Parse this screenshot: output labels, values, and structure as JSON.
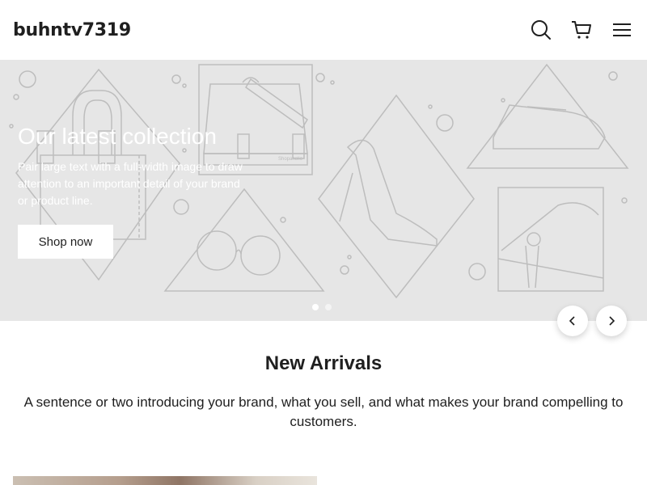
{
  "header": {
    "brand": "buhntv7319",
    "icons": [
      "search-icon",
      "cart-icon",
      "menu-icon"
    ]
  },
  "hero": {
    "title": "Our latest collection",
    "description": "Pair large text with a full-width image to draw attention to an important detail of your brand or product line.",
    "button_label": "Shop now",
    "slides": 2,
    "active_slide": 1,
    "background": "#e6e6e6",
    "art_text": "Shopaholic"
  },
  "section": {
    "title": "New Arrivals",
    "description": "A sentence or two introducing your brand, what you sell, and what makes your brand compelling to customers."
  },
  "colors": {
    "text": "#1f1f1f",
    "hero_bg": "#e6e6e6",
    "line_art": "#bdbdbd"
  }
}
